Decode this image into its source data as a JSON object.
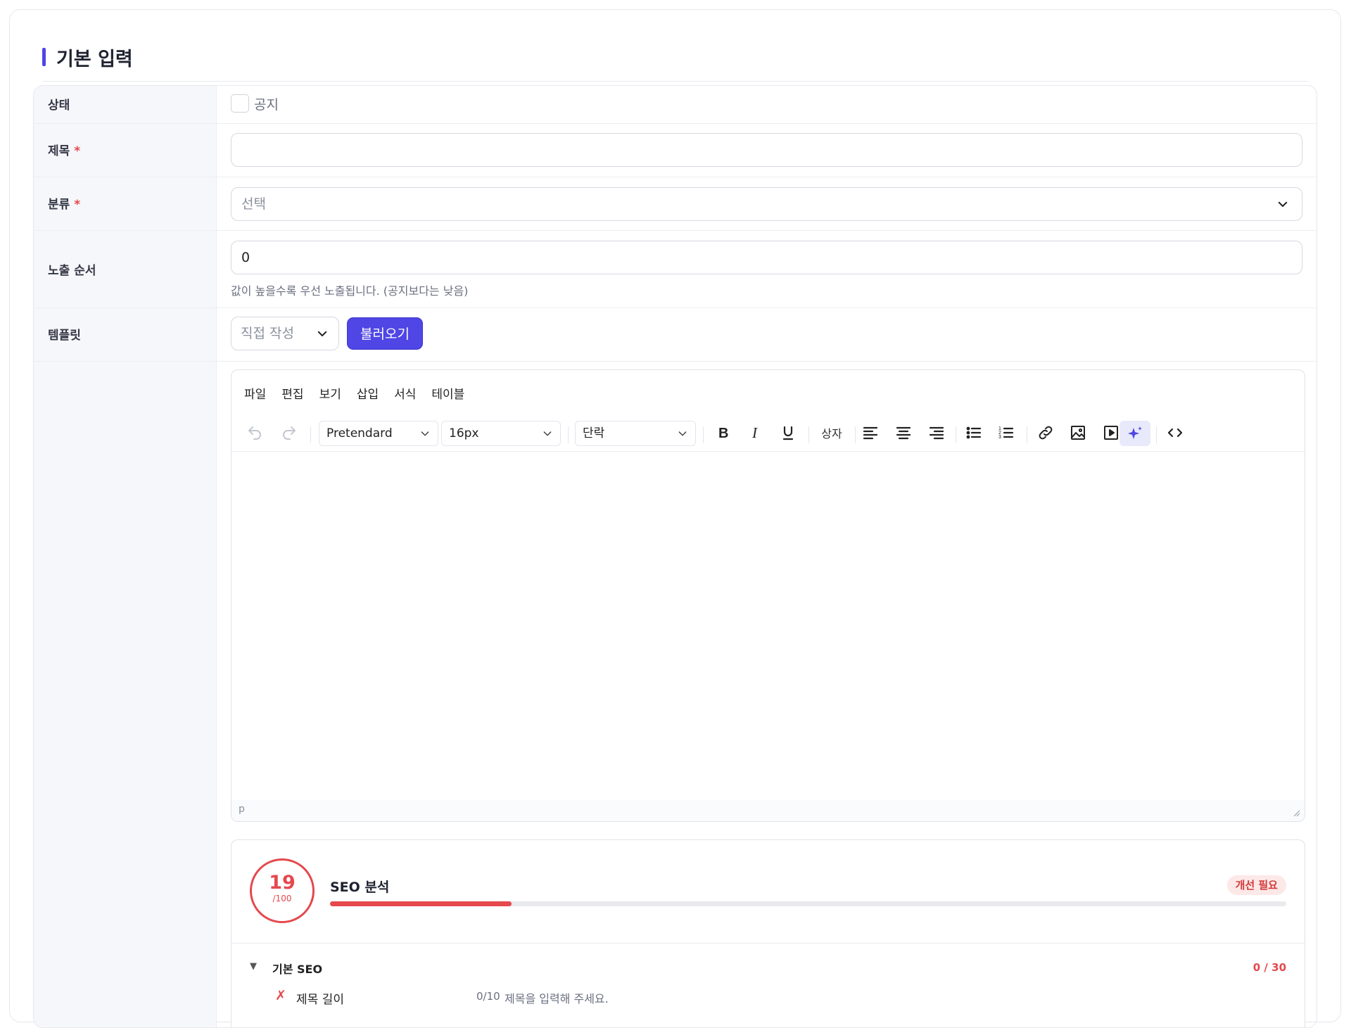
{
  "section": {
    "title": "기본 입력"
  },
  "form": {
    "status": {
      "label": "상태",
      "checkbox_label": "공지"
    },
    "title": {
      "label": "제목",
      "required_mark": "*",
      "value": ""
    },
    "category": {
      "label": "분류",
      "required_mark": "*",
      "selected": "선택"
    },
    "order": {
      "label": "노출 순서",
      "value": "0",
      "hint": "값이 높을수록 우선 노출됩니다. (공지보다는 낮음)"
    },
    "template": {
      "label": "템플릿",
      "selected": "직접 작성",
      "load_button": "불러오기"
    }
  },
  "editor": {
    "menus": [
      "파일",
      "편집",
      "보기",
      "삽입",
      "서식",
      "테이블"
    ],
    "font_family": "Pretendard",
    "font_size": "16px",
    "block_format": "단락",
    "box_label": "상자",
    "statusbar_path": "p",
    "toolbar_icons": [
      "undo-icon",
      "redo-icon",
      "bold-icon",
      "italic-icon",
      "underline-icon",
      "align-left-icon",
      "align-center-icon",
      "align-right-icon",
      "bullet-list-icon",
      "numbered-list-icon",
      "link-icon",
      "image-icon",
      "media-icon",
      "ai-sparkle-icon",
      "code-icon"
    ]
  },
  "seo": {
    "score": "19",
    "score_max": "/100",
    "score_fraction": 0.19,
    "title": "SEO 분석",
    "badge": "개선 필요",
    "group": {
      "toggle": "▼",
      "title": "기본 SEO",
      "score": "0 / 30"
    },
    "items": [
      {
        "status": "✗",
        "name": "제목 길이",
        "points": "0/10",
        "message": "제목을 입력해 주세요."
      }
    ]
  },
  "colors": {
    "accent": "#4f46e5",
    "danger": "#e5484d",
    "label_bg": "#f6f7fa"
  }
}
